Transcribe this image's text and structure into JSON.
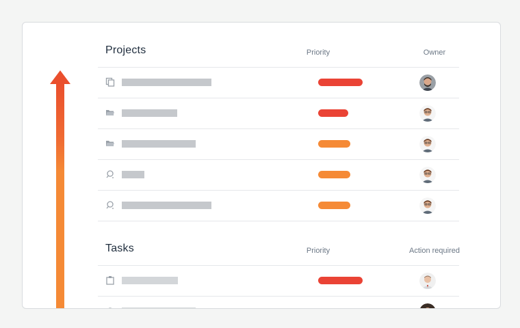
{
  "projects": {
    "title": "Projects",
    "priority_header": "Priority",
    "owner_header": "Owner",
    "rows": [
      {
        "icon": "copy-icon",
        "priority_color": "#ea4335"
      },
      {
        "icon": "folder-icon",
        "priority_color": "#ea4335"
      },
      {
        "icon": "folder-icon",
        "priority_color": "#f58a36"
      },
      {
        "icon": "search-icon",
        "priority_color": "#f58a36"
      },
      {
        "icon": "search-icon",
        "priority_color": "#f58a36"
      }
    ]
  },
  "tasks": {
    "title": "Tasks",
    "priority_header": "Priority",
    "action_header": "Action required",
    "rows": [
      {
        "icon": "clipboard-icon",
        "priority_color": "#ea4335"
      },
      {
        "icon": "gear-icon",
        "priority_color": ""
      }
    ]
  },
  "colors": {
    "high": "#ea4335",
    "medium": "#f58a36",
    "placeholder": "#c5c8cc",
    "arrow_top": "#ea4f2d",
    "arrow_bottom": "#f58a36"
  }
}
